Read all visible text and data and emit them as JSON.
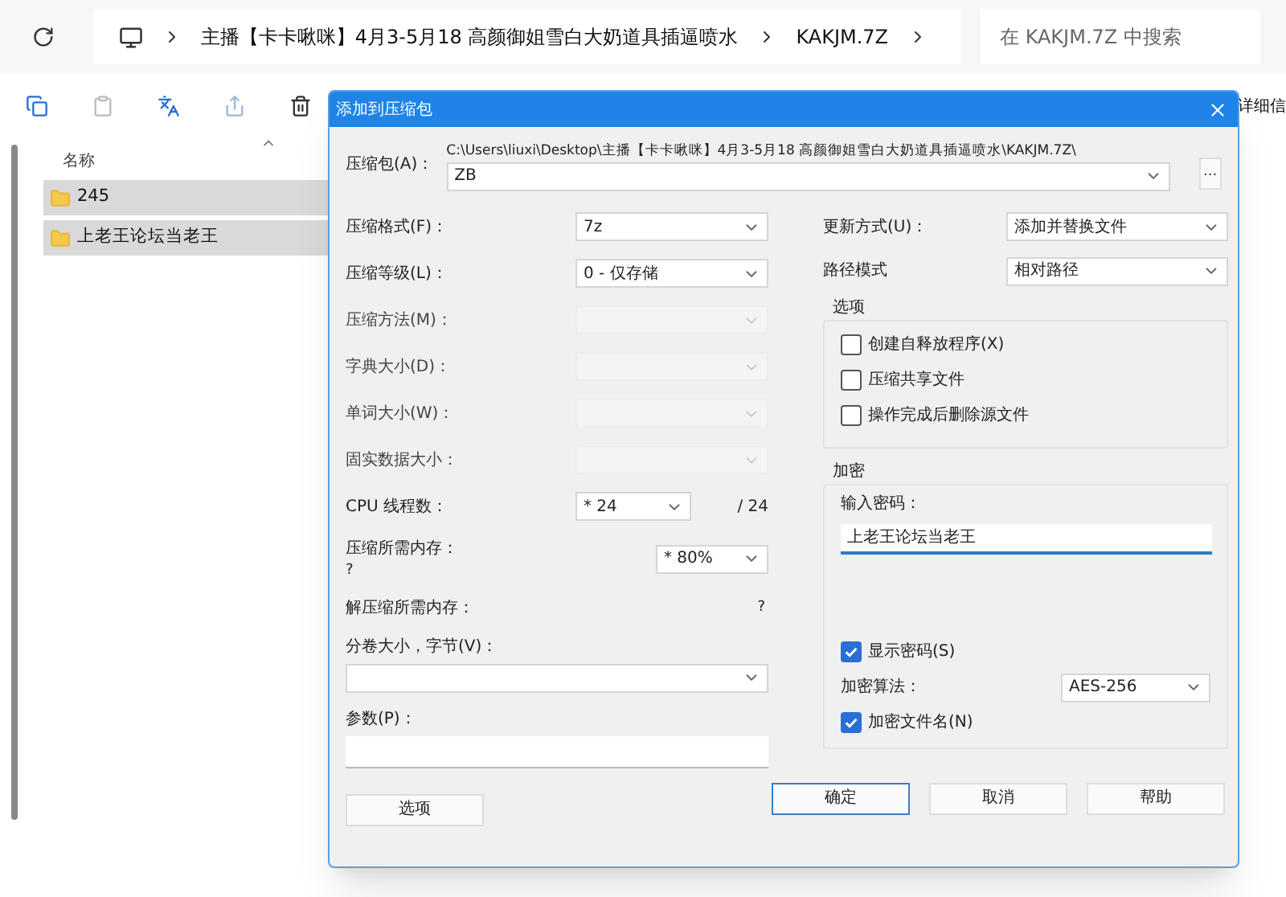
{
  "explorer": {
    "breadcrumb": [
      "主播【卡卡啾咪】4月3-5月18 高颜御姐雪白大奶道具插逼喷水",
      "KAKJM.7Z"
    ],
    "search": {
      "placeholder": "在 KAKJM.7Z 中搜索"
    },
    "toolbar_text": "详细信",
    "column": "名称",
    "folders": [
      {
        "name": "245",
        "selected": true
      },
      {
        "name": "上老王论坛当老王",
        "selected": true
      }
    ]
  },
  "dialog": {
    "title": "添加到压缩包",
    "archive": {
      "label": "压缩包(A)：",
      "path": "C:\\Users\\liuxi\\Desktop\\主播【卡卡啾咪】4月3-5月18 高颜御姐雪白大奶道具插逼喷水\\KAKJM.7Z\\",
      "value": "ZB",
      "browse": "..."
    },
    "left": [
      {
        "kind": "select",
        "label": "压缩格式(F)：",
        "value": "7z",
        "disabled": false
      },
      {
        "kind": "select",
        "label": "压缩等级(L)：",
        "value": "0 - 仅存储",
        "disabled": false
      },
      {
        "kind": "select",
        "label": "压缩方法(M)：",
        "disabled": true
      },
      {
        "kind": "select",
        "label": "字典大小(D)：",
        "disabled": true
      },
      {
        "kind": "select",
        "label": "单词大小(W)：",
        "disabled": true
      },
      {
        "kind": "select",
        "label": "固实数据大小：",
        "disabled": true
      },
      {
        "kind": "cpu",
        "label": "CPU 线程数：",
        "value": "* 24",
        "suffix": "/ 24"
      },
      {
        "kind": "memory",
        "label": "压缩所需内存：",
        "note": "?",
        "value": "* 80%"
      },
      {
        "kind": "info",
        "label": "解压缩所需内存：",
        "value": "?"
      },
      {
        "kind": "wide_select",
        "label": "分卷大小，字节(V)："
      },
      {
        "kind": "wide_input",
        "label": "参数(P)："
      }
    ],
    "options_button": "选项",
    "update": {
      "label": "更新方式(U)：",
      "value": "添加并替换文件"
    },
    "path_mode": {
      "label": "路径模式",
      "value": "相对路径"
    },
    "options": {
      "title": "选项",
      "items": [
        {
          "label": "创建自释放程序(X)",
          "checked": false
        },
        {
          "label": "压缩共享文件",
          "checked": false
        },
        {
          "label": "操作完成后删除源文件",
          "checked": false
        }
      ]
    },
    "encryption": {
      "title": "加密",
      "password_label": "输入密码：",
      "password": "上老王论坛当老王",
      "show_password": {
        "label": "显示密码(S)",
        "checked": true
      },
      "method_label": "加密算法：",
      "method": "AES-256",
      "encrypt_names": {
        "label": "加密文件名(N)",
        "checked": true
      }
    },
    "buttons": [
      {
        "label": "确定",
        "selected": true
      },
      {
        "label": "取消",
        "selected": false
      },
      {
        "label": "帮助",
        "selected": false
      }
    ]
  }
}
